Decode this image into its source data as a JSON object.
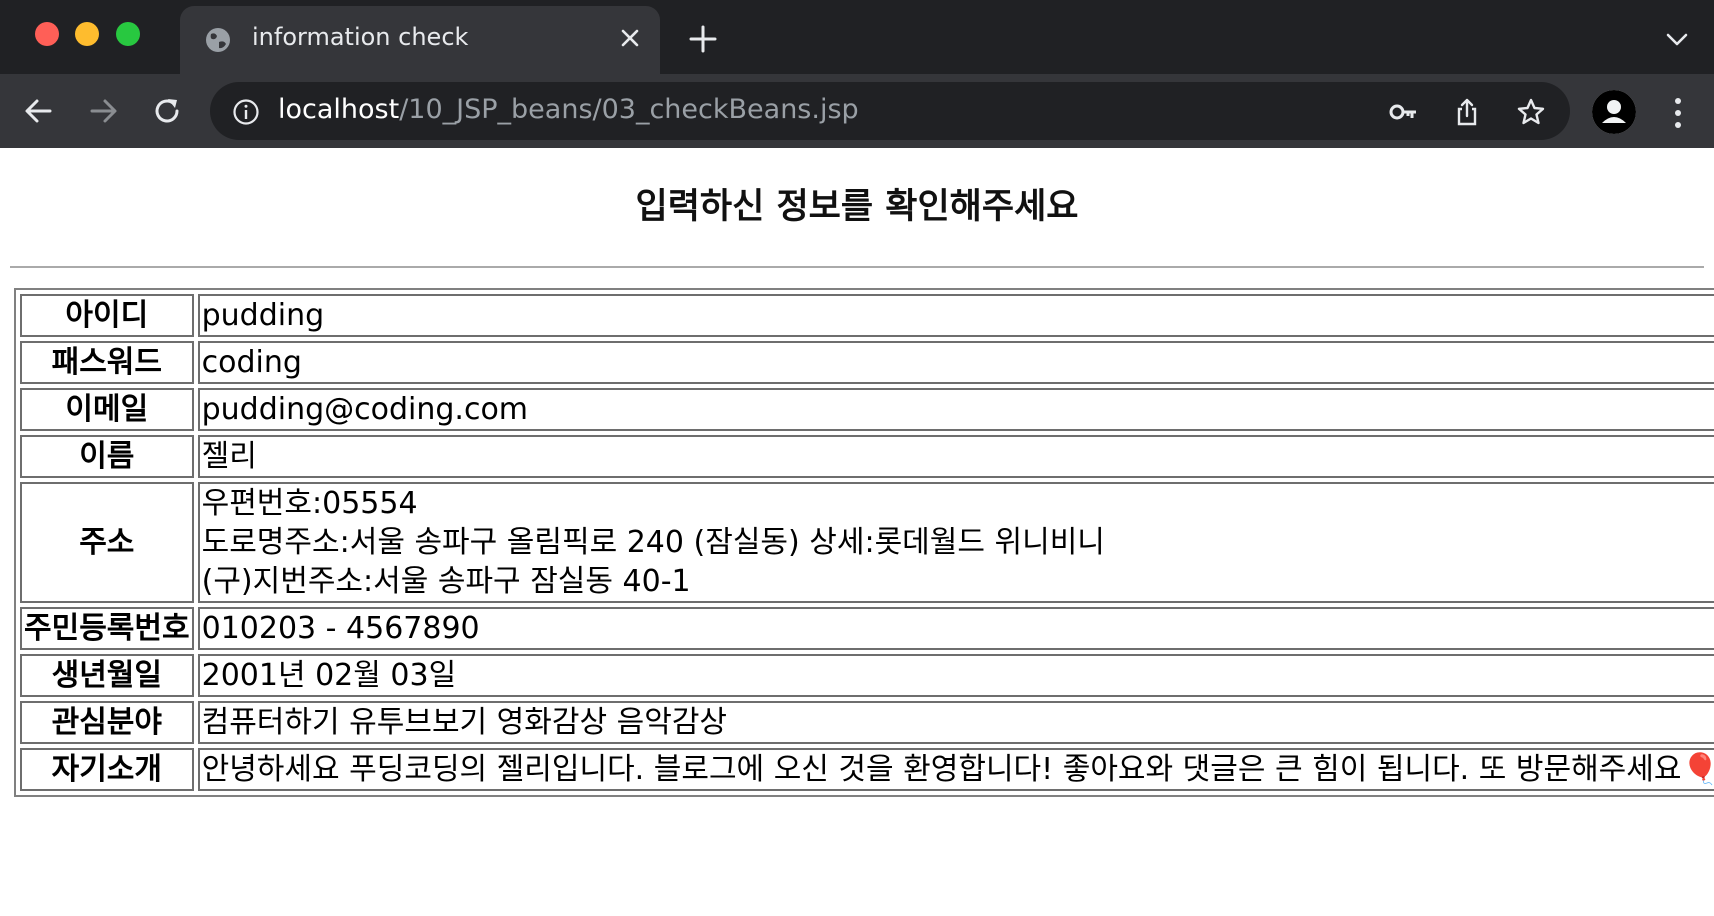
{
  "browser": {
    "tab_title": "information check",
    "url_host": "localhost",
    "url_path": "/10_JSP_beans/03_checkBeans.jsp"
  },
  "page": {
    "heading": "입력하신 정보를 확인해주세요",
    "rows": [
      {
        "label": "아이디",
        "value": "pudding"
      },
      {
        "label": "패스워드",
        "value": "coding"
      },
      {
        "label": "이메일",
        "value": "pudding@coding.com"
      },
      {
        "label": "이름",
        "value": "젤리"
      },
      {
        "label": "주소",
        "lines": [
          "우편번호:05554",
          "도로명주소:서울 송파구 올림픽로 240 (잠실동) 상세:롯데월드 위니비니",
          "(구)지번주소:서울 송파구 잠실동 40-1"
        ]
      },
      {
        "label": "주민등록번호",
        "value": "010203 - 4567890"
      },
      {
        "label": "생년월일",
        "value": "2001년 02월 03일"
      },
      {
        "label": "관심분야",
        "value": "컴퓨터하기 유투브보기 영화감상 음악감상"
      },
      {
        "label": "자기소개",
        "value": "안녕하세요 푸딩코딩의 젤리입니다. 블로그에 오신 것을 환영합니다! 좋아요와 댓글은 큰 힘이 됩니다. 또 방문해주세요🎈"
      }
    ]
  }
}
